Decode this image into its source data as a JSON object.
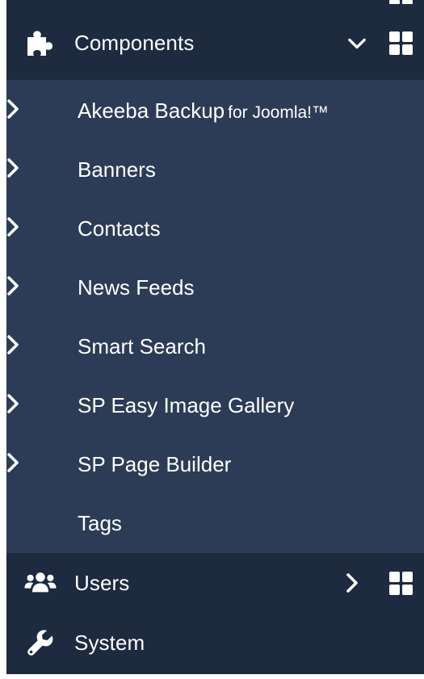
{
  "sidebar": {
    "components": {
      "label": "Components",
      "icon": "puzzle-icon",
      "expanded": true,
      "chevron": "chevron-down-icon",
      "dashboard_icon": "dashboard-grid-icon",
      "items": [
        {
          "label": "Akeeba Backup",
          "suffix": "for Joomla!™",
          "has_submenu": true
        },
        {
          "label": "Banners",
          "has_submenu": true
        },
        {
          "label": "Contacts",
          "has_submenu": true
        },
        {
          "label": "News Feeds",
          "has_submenu": true
        },
        {
          "label": "Smart Search",
          "has_submenu": true
        },
        {
          "label": "SP Easy Image Gallery",
          "has_submenu": true
        },
        {
          "label": "SP Page Builder",
          "has_submenu": true
        },
        {
          "label": "Tags",
          "has_submenu": false
        }
      ]
    },
    "users": {
      "label": "Users",
      "icon": "users-icon",
      "chevron": "chevron-right-icon",
      "dashboard_icon": "dashboard-grid-icon"
    },
    "system": {
      "label": "System",
      "icon": "wrench-icon"
    }
  },
  "colors": {
    "sidebar_bg": "#1d2a3f",
    "submenu_bg": "#2c3c56",
    "text": "#ffffff"
  }
}
